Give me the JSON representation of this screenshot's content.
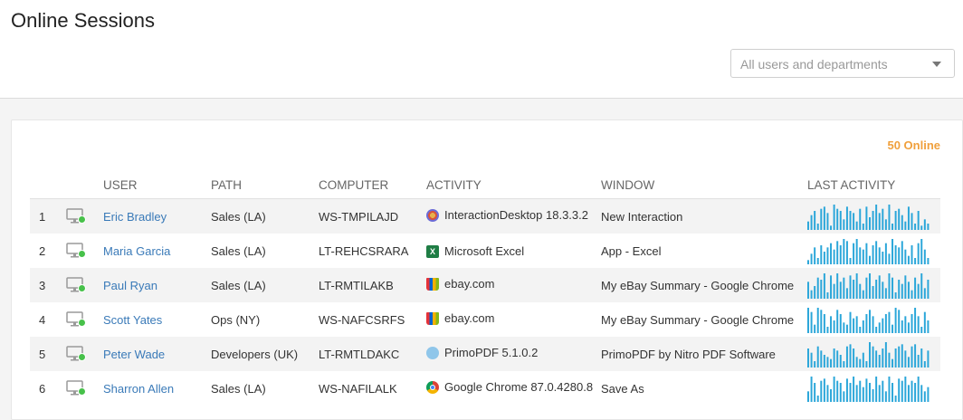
{
  "header": {
    "title": "Online Sessions",
    "department_filter": {
      "placeholder": "All users and departments"
    }
  },
  "sessions_panel": {
    "online_count": "50 Online",
    "columns": {
      "user": "USER",
      "path": "PATH",
      "computer": "COMPUTER",
      "activity": "ACTIVITY",
      "window": "WINDOW",
      "last_activity": "LAST ACTIVITY"
    },
    "rows": [
      {
        "num": "1",
        "user": "Eric Bradley",
        "path": "Sales (LA)",
        "computer": "WS-TMPILAJD",
        "activity": "InteractionDesktop 18.3.3.2",
        "activity_icon": "interaction-desktop-icon",
        "window": "New Interaction",
        "spark": [
          8,
          14,
          18,
          6,
          20,
          22,
          16,
          4,
          24,
          20,
          18,
          10,
          22,
          18,
          16,
          8,
          20,
          6,
          22,
          12,
          18,
          24,
          16,
          20,
          10,
          24,
          6,
          18,
          20,
          14,
          8,
          22,
          16,
          6,
          18,
          4,
          10,
          6
        ]
      },
      {
        "num": "2",
        "user": "Maria Garcia",
        "path": "Sales (LA)",
        "computer": "LT-REHCSRARA",
        "activity": "Microsoft Excel",
        "activity_icon": "excel-icon",
        "window": "App - Excel",
        "spark": [
          4,
          10,
          16,
          6,
          18,
          12,
          16,
          20,
          14,
          22,
          18,
          24,
          22,
          6,
          20,
          24,
          16,
          14,
          20,
          8,
          18,
          22,
          16,
          12,
          20,
          10,
          24,
          18,
          16,
          22,
          14,
          8,
          18,
          6,
          20,
          24,
          14,
          6
        ]
      },
      {
        "num": "3",
        "user": "Paul Ryan",
        "path": "Sales (LA)",
        "computer": "LT-RMTILAKB",
        "activity": "ebay.com",
        "activity_icon": "ebay-icon",
        "window": "My eBay Summary - Google Chrome",
        "spark": [
          16,
          8,
          12,
          20,
          18,
          24,
          6,
          22,
          14,
          24,
          16,
          20,
          10,
          22,
          18,
          24,
          14,
          8,
          20,
          24,
          12,
          18,
          22,
          16,
          10,
          24,
          20,
          6,
          18,
          14,
          22,
          16,
          8,
          20,
          14,
          24,
          10,
          18
        ]
      },
      {
        "num": "4",
        "user": "Scott Yates",
        "path": "Ops (NY)",
        "computer": "WS-NAFCSRFS",
        "activity": "ebay.com",
        "activity_icon": "ebay-icon",
        "window": "My eBay Summary - Google Chrome",
        "spark": [
          24,
          20,
          8,
          24,
          22,
          18,
          6,
          16,
          12,
          22,
          18,
          10,
          8,
          20,
          14,
          16,
          6,
          12,
          18,
          22,
          16,
          6,
          10,
          14,
          18,
          20,
          8,
          24,
          22,
          12,
          16,
          10,
          18,
          24,
          16,
          6,
          20,
          12
        ]
      },
      {
        "num": "5",
        "user": "Peter Wade",
        "path": "Developers (UK)",
        "computer": "LT-RMTLDAKC",
        "activity": "PrimoPDF 5.1.0.2",
        "activity_icon": "primopdf-icon",
        "window": "PrimoPDF by Nitro PDF Software",
        "spark": [
          18,
          14,
          6,
          20,
          16,
          12,
          10,
          8,
          18,
          16,
          12,
          6,
          20,
          22,
          18,
          10,
          8,
          14,
          6,
          24,
          20,
          16,
          12,
          18,
          24,
          14,
          8,
          18,
          20,
          22,
          16,
          10,
          20,
          22,
          12,
          18,
          6,
          16
        ]
      },
      {
        "num": "6",
        "user": "Sharron Allen",
        "path": "Sales (LA)",
        "computer": "WS-NAFILALK",
        "activity": "Google Chrome 87.0.4280.8",
        "activity_icon": "chrome-icon",
        "window": "Save As",
        "spark": [
          10,
          24,
          18,
          6,
          20,
          22,
          16,
          12,
          24,
          20,
          18,
          10,
          22,
          18,
          24,
          16,
          20,
          14,
          22,
          18,
          12,
          24,
          16,
          20,
          10,
          24,
          18,
          6,
          22,
          20,
          24,
          16,
          20,
          18,
          24,
          16,
          10,
          14
        ]
      }
    ]
  }
}
